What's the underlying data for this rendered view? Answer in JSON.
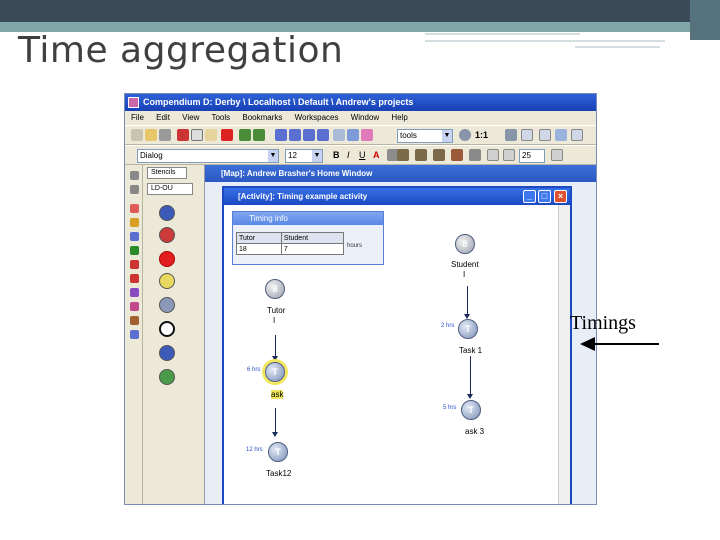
{
  "slide": {
    "title": "Time aggregation",
    "annotation": "Timings"
  },
  "app": {
    "window_title": "Compendium D: Derby \\ Localhost \\ Default \\ Andrew's projects",
    "menu": [
      "File",
      "Edit",
      "View",
      "Tools",
      "Bookmarks",
      "Workspaces",
      "Window",
      "Help"
    ],
    "toolbar": {
      "search_value": "tools",
      "zoom_label": "1:1",
      "font_value": "Dialog",
      "font_size": "12",
      "bold": "B",
      "italic": "I",
      "underline": "U",
      "font_color": "A",
      "line_size": "25"
    },
    "palette": {
      "tab_label": "Stencils",
      "combo_value": "LD-OU"
    },
    "map_window_title": "[Map]: Andrew Brasher's Home Window",
    "activity_window_title": "[Activity]: Timing example activity",
    "timing_info": {
      "title": "Timing info",
      "headers": [
        "Tutor",
        "Student"
      ],
      "values": [
        "18",
        "7"
      ],
      "extra": "hours"
    },
    "nodes": {
      "student": {
        "icon": "person-icon",
        "label_line1": "Student",
        "label_line2": "I"
      },
      "tutor": {
        "icon": "person-icon",
        "label_line1": "Tutor",
        "label_line2": "I"
      },
      "task_a": {
        "icon": "task-icon",
        "glyph": "T",
        "label": "ask",
        "hours": "6 hrs"
      },
      "task_b": {
        "icon": "task-icon",
        "glyph": "T",
        "label": "Task12",
        "hours": "12 hrs"
      },
      "task1": {
        "icon": "task-icon",
        "glyph": "T",
        "label": "Task 1",
        "hours": "2 hrs"
      },
      "task3": {
        "icon": "task-icon",
        "glyph": "T",
        "label": "ask 3",
        "hours": "5 hrs"
      }
    },
    "colors": {
      "titlebar": "#1d48c2",
      "highlight": "#f2e75c",
      "slide_band": "#3a4a57"
    }
  }
}
